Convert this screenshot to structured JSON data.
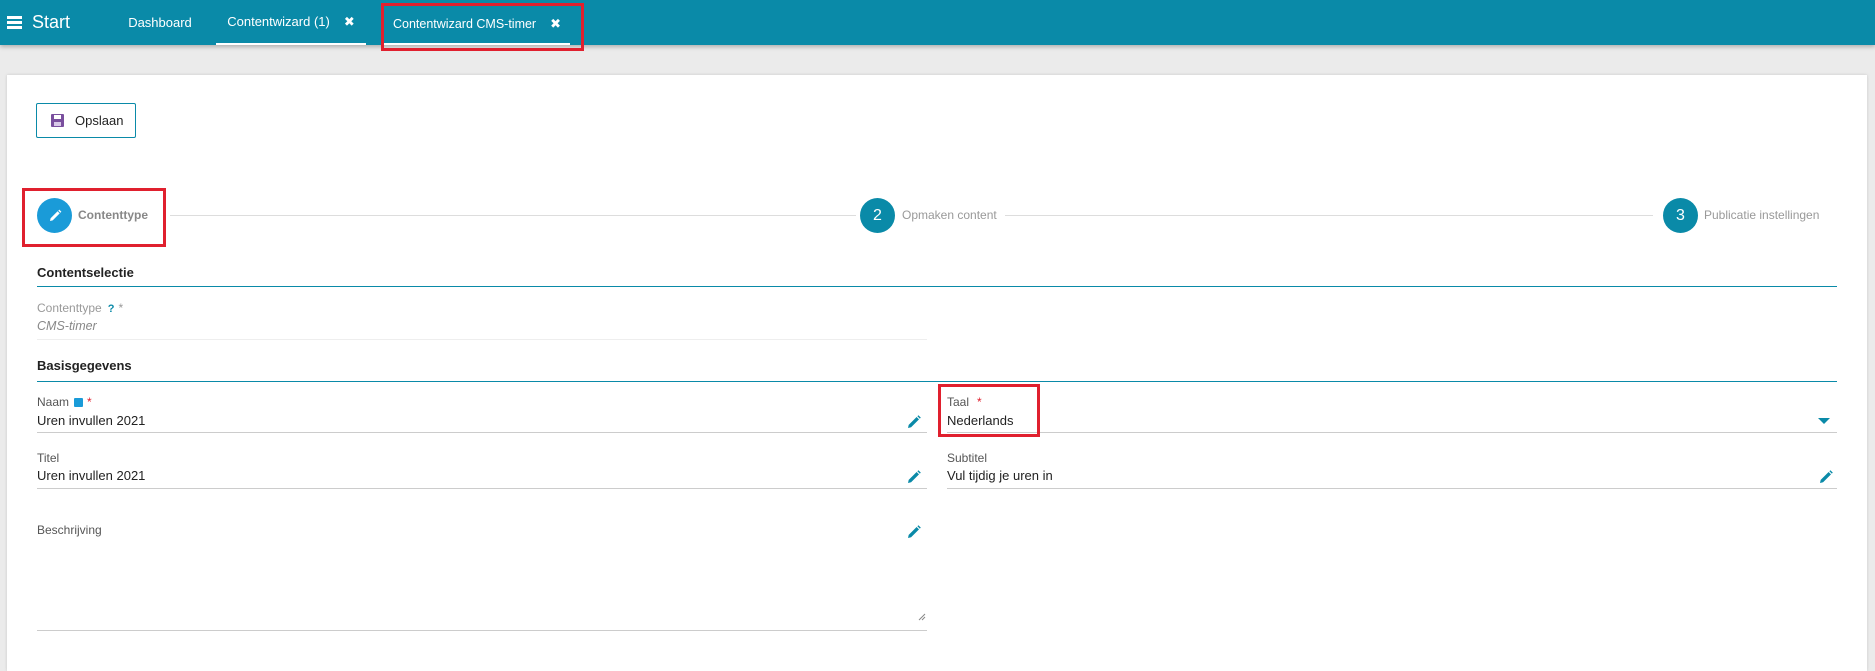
{
  "topbar": {
    "start_label": "Start",
    "tabs": [
      {
        "label": "Dashboard"
      },
      {
        "label": "Contentwizard (1)",
        "close": "✖"
      },
      {
        "label": "Contentwizard CMS-timer",
        "close": "✖"
      }
    ]
  },
  "toolbar": {
    "save_label": "Opslaan"
  },
  "stepper": {
    "steps": [
      {
        "number": "",
        "label": "Contenttype",
        "icon": "pencil-icon"
      },
      {
        "number": "2",
        "label": "Opmaken content"
      },
      {
        "number": "3",
        "label": "Publicatie instellingen"
      }
    ]
  },
  "sections": {
    "contentselectie": {
      "title": "Contentselectie",
      "contenttype_label": "Contenttype",
      "contenttype_help": "?",
      "contenttype_required": "*",
      "contenttype_value": "CMS-timer"
    },
    "basisgegevens": {
      "title": "Basisgegevens",
      "naam_label": "Naam",
      "naam_required": "*",
      "naam_value": "Uren invullen 2021",
      "taal_label": "Taal",
      "taal_required": "*",
      "taal_value": "Nederlands",
      "titel_label": "Titel",
      "titel_value": "Uren invullen 2021",
      "subtitel_label": "Subtitel",
      "subtitel_value": "Vul tijdig je uren in",
      "beschrijving_label": "Beschrijving",
      "beschrijving_value": ""
    }
  },
  "colors": {
    "accent": "#0a8aa8",
    "active_step": "#1a9bd8",
    "required": "#e0202e",
    "highlight": "#e0202e"
  }
}
